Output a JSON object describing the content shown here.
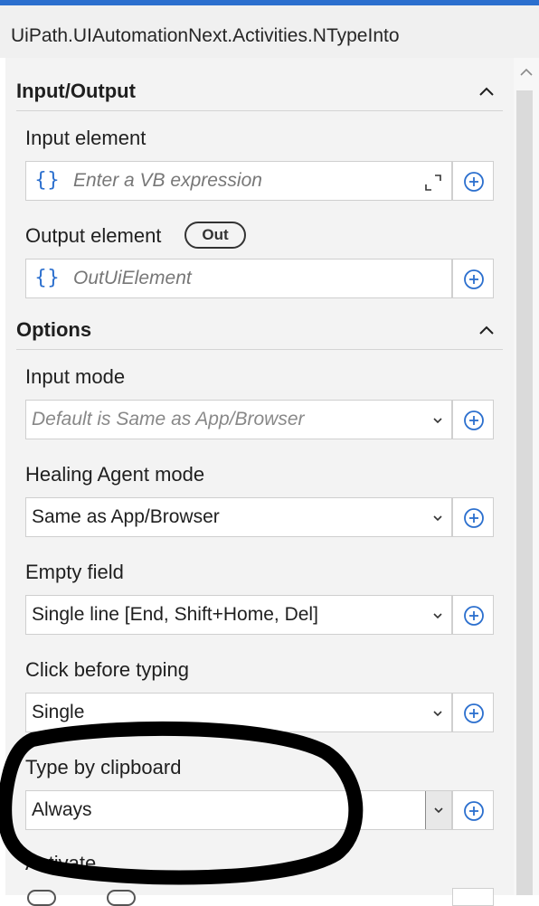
{
  "header": {
    "title": "UiPath.UIAutomationNext.Activities.NTypeInto"
  },
  "sections": {
    "input_output": {
      "title": "Input/Output"
    },
    "options": {
      "title": "Options"
    }
  },
  "fields": {
    "input_element": {
      "label": "Input element",
      "placeholder": "Enter a VB expression"
    },
    "output_element": {
      "label": "Output element",
      "badge": "Out",
      "value": "OutUiElement"
    },
    "input_mode": {
      "label": "Input mode",
      "value": "Default is Same as App/Browser"
    },
    "healing_agent_mode": {
      "label": "Healing Agent mode",
      "value": "Same as App/Browser"
    },
    "empty_field": {
      "label": "Empty field",
      "value": "Single line [End, Shift+Home, Del]"
    },
    "click_before_typing": {
      "label": "Click before typing",
      "value": "Single"
    },
    "type_by_clipboard": {
      "label": "Type by clipboard",
      "value": "Always"
    },
    "activate": {
      "label": "Activate"
    }
  },
  "icons": {
    "braces": "{}",
    "accent": "#2b6fce"
  }
}
